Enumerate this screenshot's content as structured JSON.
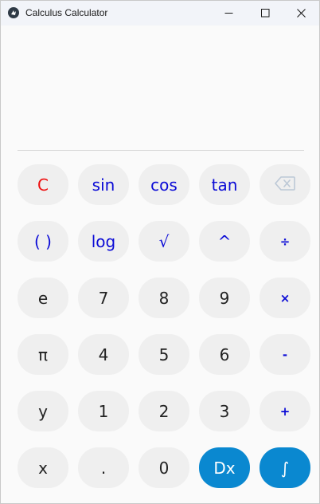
{
  "window": {
    "title": "Calculus Calculator",
    "icons": {
      "app": "kivy-logo-icon",
      "minimize": "minimize-icon",
      "maximize": "maximize-icon",
      "close": "close-icon"
    }
  },
  "display": {
    "expression": ""
  },
  "colors": {
    "key_bg": "#efefef",
    "key_text": "#222222",
    "operator_text": "#0a0ad6",
    "clear_text": "#ee1111",
    "accent": "#0a88d0",
    "accent_text": "#ffffff"
  },
  "keys": {
    "clear": "C",
    "sin": "sin",
    "cos": "cos",
    "tan": "tan",
    "backspace_icon": "backspace-icon",
    "parens": "( )",
    "log": "log",
    "sqrt": "√",
    "power": "^",
    "divide": "÷",
    "e": "e",
    "seven": "7",
    "eight": "8",
    "nine": "9",
    "multiply": "×",
    "pi": "π",
    "four": "4",
    "five": "5",
    "six": "6",
    "minus": "-",
    "y": "y",
    "one": "1",
    "two": "2",
    "three": "3",
    "plus": "+",
    "x": "x",
    "dot": ".",
    "zero": "0",
    "derivative": "Dx",
    "integral": "∫"
  }
}
